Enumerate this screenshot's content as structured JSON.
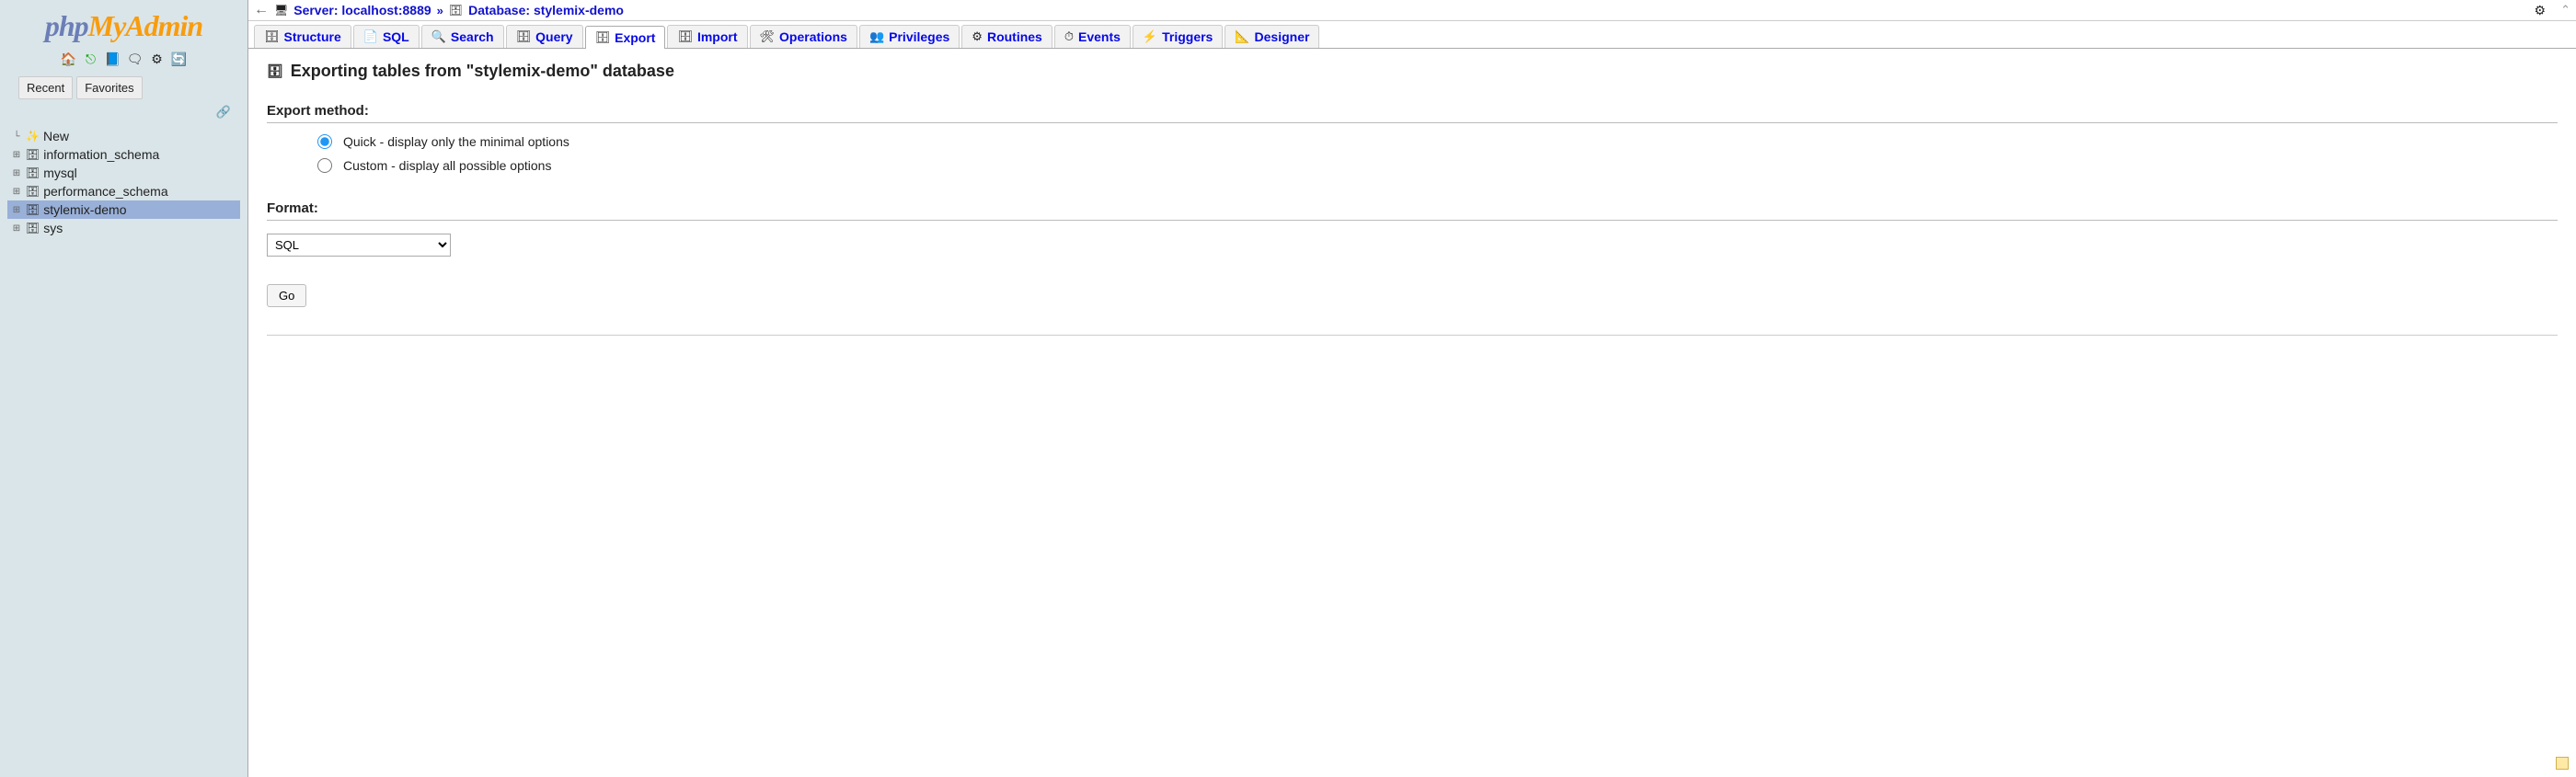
{
  "logo": {
    "part1": "php",
    "part2": "MyAdmin"
  },
  "sidebar_tabs": {
    "recent": "Recent",
    "favorites": "Favorites"
  },
  "tree": {
    "new": "New",
    "items": [
      "information_schema",
      "mysql",
      "performance_schema",
      "stylemix-demo",
      "sys"
    ],
    "selected": "stylemix-demo"
  },
  "breadcrumb": {
    "server_label": "Server: ",
    "server_value": "localhost:8889",
    "separator": "»",
    "database_label": "Database: ",
    "database_value": "stylemix-demo"
  },
  "tabs": [
    {
      "label": "Structure",
      "active": false
    },
    {
      "label": "SQL",
      "active": false
    },
    {
      "label": "Search",
      "active": false
    },
    {
      "label": "Query",
      "active": false
    },
    {
      "label": "Export",
      "active": true
    },
    {
      "label": "Import",
      "active": false
    },
    {
      "label": "Operations",
      "active": false
    },
    {
      "label": "Privileges",
      "active": false
    },
    {
      "label": "Routines",
      "active": false
    },
    {
      "label": "Events",
      "active": false
    },
    {
      "label": "Triggers",
      "active": false
    },
    {
      "label": "Designer",
      "active": false
    }
  ],
  "page": {
    "title": "Exporting tables from \"stylemix-demo\" database",
    "export_method_label": "Export method:",
    "radio_quick": "Quick - display only the minimal options",
    "radio_custom": "Custom - display all possible options",
    "format_label": "Format:",
    "format_value": "SQL",
    "go_button": "Go"
  }
}
